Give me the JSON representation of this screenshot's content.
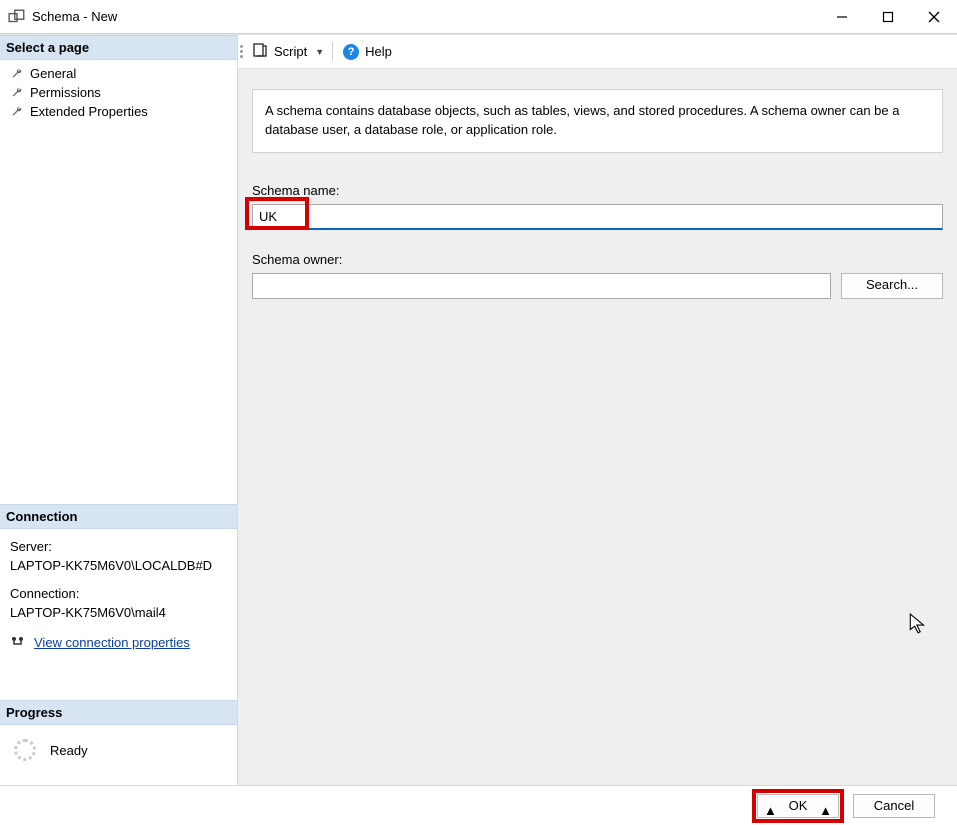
{
  "window": {
    "title": "Schema - New"
  },
  "sidebar": {
    "select_page_header": "Select a page",
    "pages": [
      {
        "label": "General"
      },
      {
        "label": "Permissions"
      },
      {
        "label": "Extended Properties"
      }
    ],
    "connection_header": "Connection",
    "server_label": "Server:",
    "server_value": "LAPTOP-KK75M6V0\\LOCALDB#D",
    "connection_label": "Connection:",
    "connection_value": "LAPTOP-KK75M6V0\\mail4",
    "view_conn_link": "View connection properties",
    "progress_header": "Progress",
    "progress_status": "Ready"
  },
  "toolbar": {
    "script_label": "Script",
    "help_label": "Help"
  },
  "content": {
    "description": "A schema contains database objects, such as tables, views, and stored procedures. A schema owner can be a database user, a database role, or application role.",
    "schema_name_label": "Schema name:",
    "schema_name_value": "UK",
    "schema_owner_label": "Schema owner:",
    "schema_owner_value": "",
    "search_button": "Search..."
  },
  "footer": {
    "ok": "OK",
    "cancel": "Cancel"
  }
}
